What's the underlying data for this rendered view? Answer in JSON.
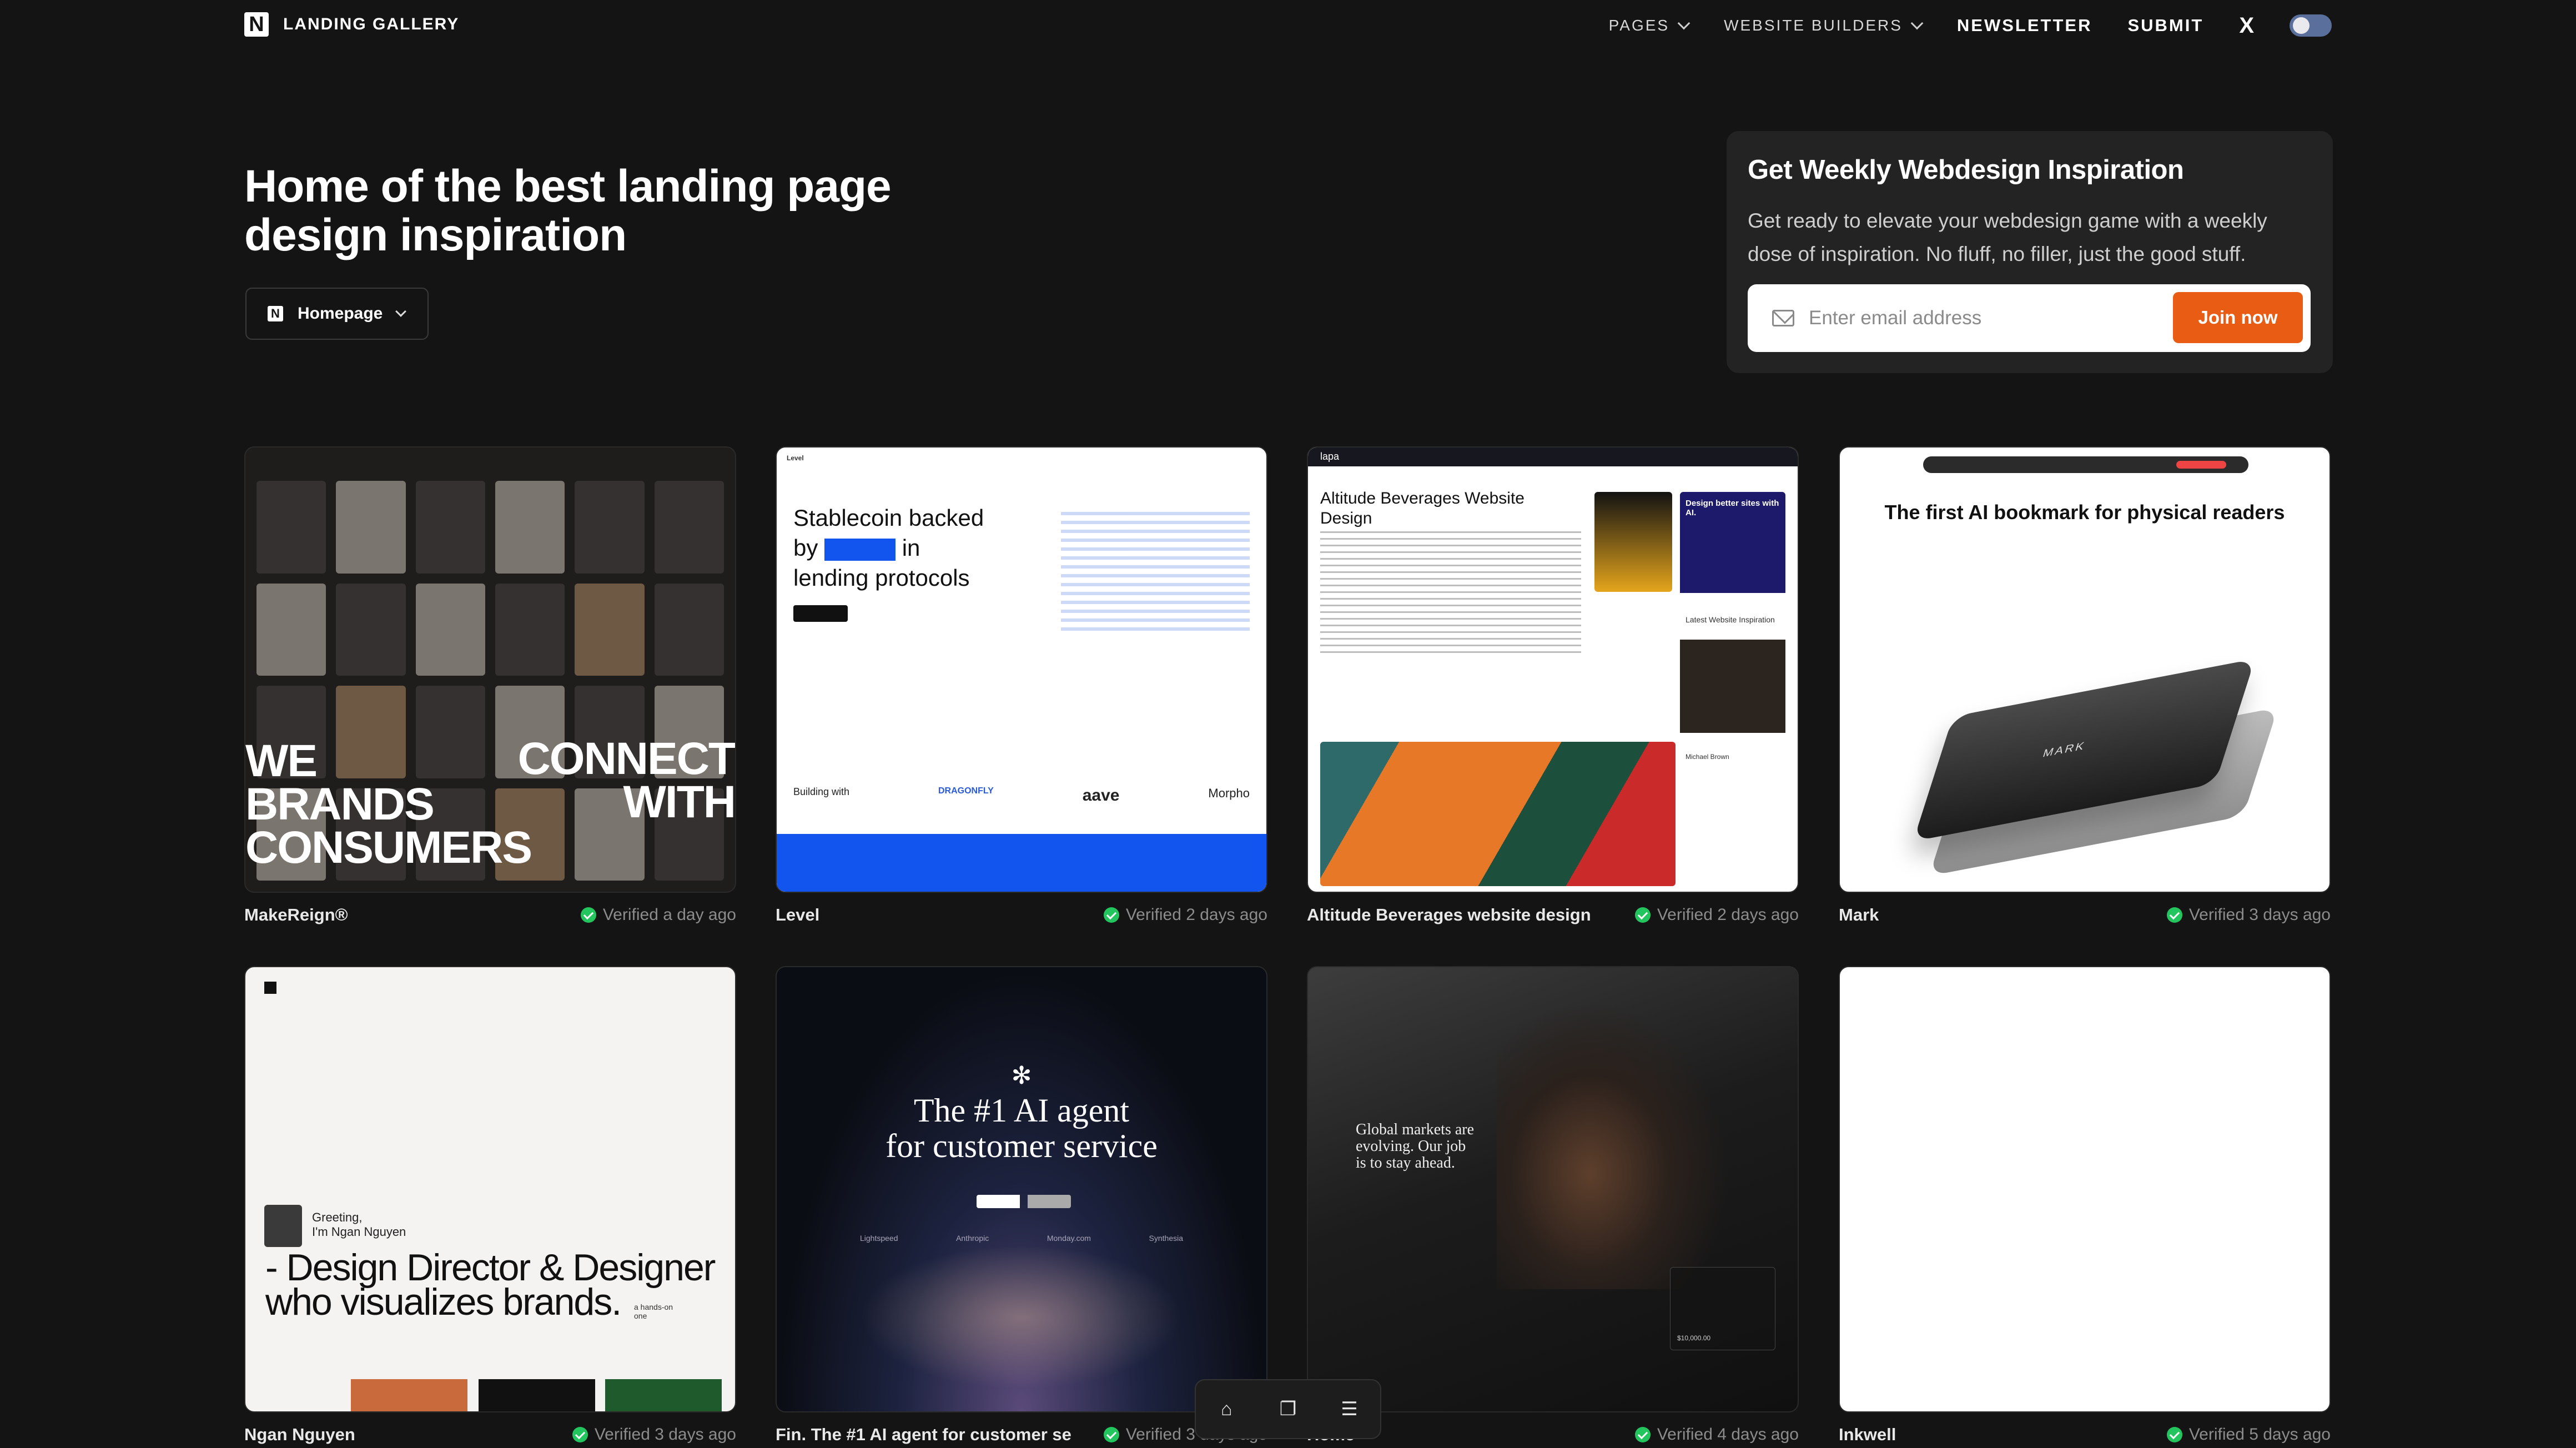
{
  "header": {
    "logo_text": "LANDING GALLERY",
    "nav": [
      {
        "label": "PAGES",
        "has_dropdown": true
      },
      {
        "label": "WEBSITE BUILDERS",
        "has_dropdown": true
      },
      {
        "label": "NEWSLETTER",
        "has_dropdown": false
      },
      {
        "label": "SUBMIT",
        "has_dropdown": false
      }
    ],
    "x_icon": "X",
    "theme_toggle": "dark-mode-toggle"
  },
  "hero": {
    "title": "Home of the best landing page design inspiration",
    "category_select": {
      "selected": "Homepage"
    }
  },
  "newsletter": {
    "title": "Get Weekly Webdesign Inspiration",
    "body": "Get ready to elevate your webdesign game with a weekly dose of inspiration. No fluff, no filler, just the good stuff.",
    "email_placeholder": "Enter email address",
    "button_label": "Join now",
    "accent": "#e85d13"
  },
  "gallery": [
    {
      "name": "MakeReign®",
      "verified": "Verified a day ago",
      "preview": {
        "big_left": "WE\nBRANDS\nCONSUMERS",
        "big_right": "CONNECT\nWITH"
      }
    },
    {
      "name": "Level",
      "verified": "Verified 2 days ago",
      "preview": {
        "headline_a": "Stablecoin backed",
        "headline_b1": "by",
        "headline_b2": "in",
        "headline_c": "lending protocols",
        "brand": "Level",
        "logos": [
          "Building with",
          "DRAGONFLY",
          "aave",
          "Morpho"
        ]
      }
    },
    {
      "name": "Altitude Beverages website design",
      "verified": "Verified 2 days ago",
      "preview": {
        "brand": "lapa",
        "headline": "Altitude Beverages Website Design",
        "side_a": "Design better sites with AI.",
        "side_b": "Latest Website Inspiration",
        "author": "Michael Brown"
      }
    },
    {
      "name": "Mark",
      "verified": "Verified 3 days ago",
      "preview": {
        "headline": "The first AI bookmark for physical readers",
        "device_label": "MARK"
      }
    },
    {
      "name": "Ngan Nguyen",
      "verified": "Verified 3 days ago",
      "preview": {
        "greeting": "Greeting,\nI'm Ngan Nguyen",
        "headline": "- Design Director & Designer\nwho visualizes brands.",
        "tag": "a hands-on one"
      }
    },
    {
      "name": "Fin. The #1 AI agent for customer se",
      "verified": "Verified 3 days ago",
      "preview": {
        "headline": "The #1 AI agent\nfor customer service",
        "logos": [
          "Lightspeed",
          "Anthropic",
          "Monday.com",
          "Synthesia"
        ]
      }
    },
    {
      "name": "Home",
      "verified": "Verified 4 days ago",
      "preview": {
        "headline": "Global markets are\nevolving. Our job\nis to stay ahead.",
        "amount": "$10,000.00"
      }
    },
    {
      "name": "Inkwell",
      "verified": "Verified 5 days ago",
      "preview": {}
    }
  ],
  "floating_toolbar": {
    "icons": [
      "home-icon",
      "layers-icon",
      "filters-icon"
    ]
  },
  "colors": {
    "background": "#141414",
    "verified": "#22c55e",
    "level_blue": "#1155ee"
  }
}
